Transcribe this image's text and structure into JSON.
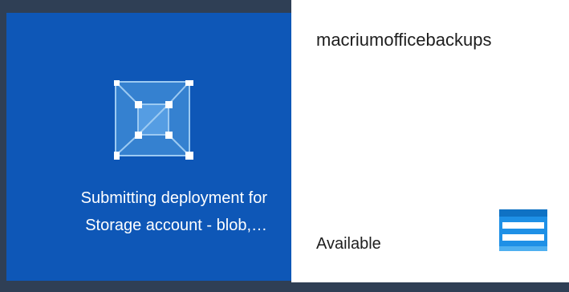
{
  "deployment_tile": {
    "line1": "Submitting deployment for",
    "line2": "Storage account - blob,…",
    "icon": "deployment-cube-icon",
    "background": "#0e57b7"
  },
  "storage_tile": {
    "name": "macriumofficebackups",
    "status": "Available",
    "icon": "storage-table-icon",
    "icon_color": "#1e90e6"
  },
  "colors": {
    "backdrop": "#2f3f55",
    "tile_white": "#ffffff",
    "text_dark": "#1e1e1e"
  }
}
